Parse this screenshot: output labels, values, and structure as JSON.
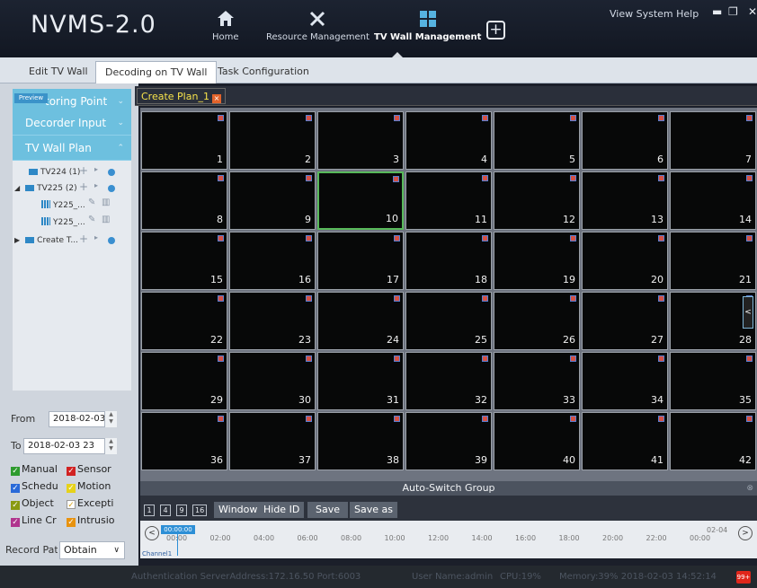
{
  "app": {
    "title": "NVMS-2.0"
  },
  "nav": {
    "home": "Home",
    "resource": "Resource Management",
    "tvwall": "TV Wall Management"
  },
  "toplinks": {
    "text": "View  System  Help"
  },
  "tabs": [
    "Edit TV Wall",
    "Decoding on TV Wall",
    "Task Configuration"
  ],
  "active_tab": "Decoding on TV Wall",
  "left": {
    "preview_badge": "Preview",
    "monitoring_point": "toring Point",
    "decoder_input": "Decorder Input",
    "tv_wall_plan": "TV Wall Plan",
    "tree": [
      {
        "label": "TV224 (1)"
      },
      {
        "label": "TV225 (2)"
      },
      {
        "label": "Y225_..."
      },
      {
        "label": "Y225_..."
      },
      {
        "label": "Create T..."
      }
    ],
    "from_label": "From",
    "from_value": "2018-02-03",
    "to_label": "To",
    "to_value": "2018-02-03 23",
    "record_types": [
      {
        "label": "Manual",
        "color": "#2e9b2e"
      },
      {
        "label": "Sensor",
        "color": "#d12222"
      },
      {
        "label": "Schedu",
        "color": "#2a6ad8"
      },
      {
        "label": "Motion",
        "color": "#e6d21a"
      },
      {
        "label": "Object",
        "color": "#8a9a12"
      },
      {
        "label": "Excepti",
        "color": "#e8e8e8"
      },
      {
        "label": "Line Cr",
        "color": "#b0358e"
      },
      {
        "label": "Intrusio",
        "color": "#e8920e"
      }
    ],
    "record_path_label": "Record Path",
    "record_path_value": "Obtain"
  },
  "plan": {
    "tab_label": "Create Plan_1",
    "close_icon": "×"
  },
  "wall": {
    "cells": [
      "1",
      "2",
      "3",
      "4",
      "5",
      "6",
      "7",
      "8",
      "9",
      "10",
      "11",
      "12",
      "13",
      "14",
      "15",
      "16",
      "17",
      "18",
      "19",
      "20",
      "21",
      "22",
      "23",
      "24",
      "25",
      "26",
      "27",
      "28",
      "29",
      "30",
      "31",
      "32",
      "33",
      "34",
      "35",
      "36",
      "37",
      "38",
      "39",
      "40",
      "41",
      "42"
    ],
    "selected": "10",
    "side_tab": "<"
  },
  "auto_switch": {
    "label": "Auto-Switch Group"
  },
  "controls": {
    "layouts": [
      "1",
      "4",
      "9",
      "16"
    ],
    "window": "Window",
    "hide_id": "Hide ID",
    "save": "Save",
    "save_as": "Save as"
  },
  "timeline": {
    "current": "00:00:00",
    "ticks": [
      "00:00",
      "02:00",
      "04:00",
      "06:00",
      "08:00",
      "10:00",
      "12:00",
      "14:00",
      "16:00",
      "18:00",
      "20:00",
      "22:00",
      "00:00"
    ],
    "end_date": "02-04",
    "channel": "Channel1"
  },
  "status": {
    "server": "Authentication ServerAddress:172.16.50 Port:6003",
    "user": "User Name:admin",
    "cpu": "CPU:19%",
    "memory": "Memory:39%  2018-02-03 14:52:14",
    "alarm_count": "99+"
  },
  "colors": {
    "accent": "#6dc0df",
    "selected_cell": "#58b95a",
    "plan_tab": "#f7e34b"
  },
  "icons": [
    "home-icon",
    "tools-icon",
    "tv-wall-icon",
    "plus-icon",
    "minimize-icon",
    "restore-icon",
    "close-icon"
  ]
}
